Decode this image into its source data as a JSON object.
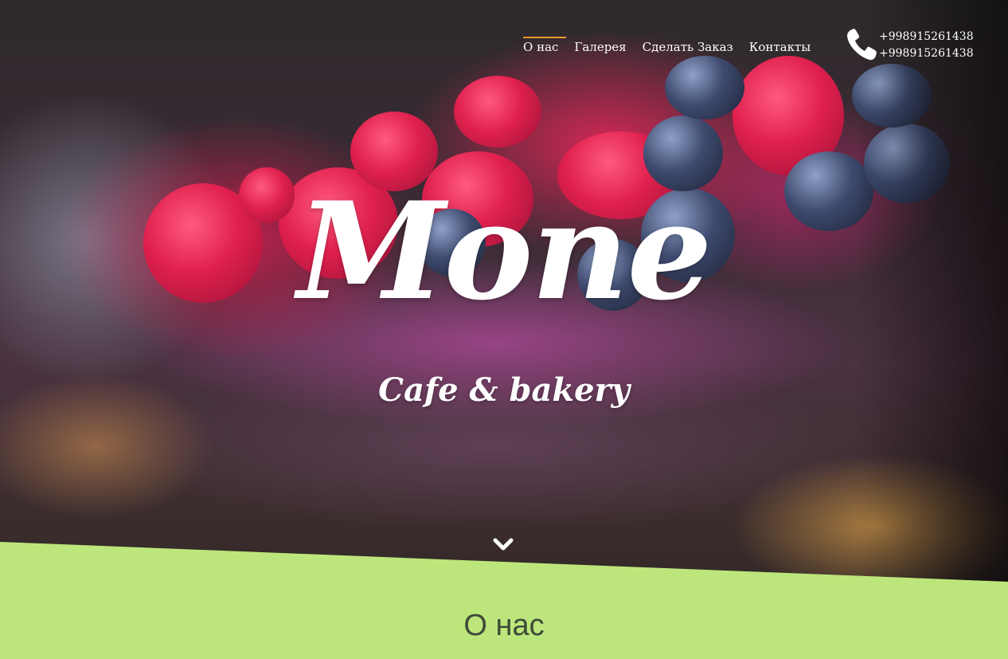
{
  "nav": {
    "items": [
      {
        "label": "О нас",
        "active": true
      },
      {
        "label": "Галерея",
        "active": false
      },
      {
        "label": "Сделать Заказ",
        "active": false
      },
      {
        "label": "Контакты",
        "active": false
      }
    ],
    "active_color": "#e89a2c"
  },
  "contact": {
    "icon": "phone-icon",
    "phones": [
      "+998915261438",
      "+998915261438"
    ]
  },
  "hero": {
    "title": "Mone",
    "subtitle": "Cafe & bakery",
    "scroll_icon": "chevron-down-icon"
  },
  "about": {
    "title": "О нас",
    "background_color": "#bce67b"
  }
}
